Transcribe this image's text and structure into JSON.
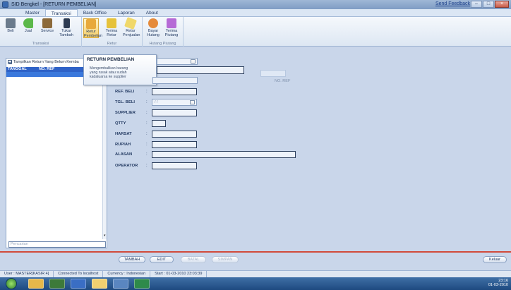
{
  "window": {
    "title": "SID Bengkel - [RETURN PEMBELIAN]",
    "send_feedback": "Send Feedback",
    "min": "–",
    "max": "□",
    "close": "×"
  },
  "ribbon": {
    "tabs": [
      "Master",
      "Transaksi",
      "Back Office",
      "Laporan",
      "About"
    ],
    "groups": {
      "transaksi": {
        "label": "Transaksi",
        "buttons": [
          "Beli",
          "Jual",
          "Service",
          "Tukar Tambah"
        ]
      },
      "retur": {
        "label": "Retur",
        "buttons": [
          "Retur Pembelian",
          "Terima Retur",
          "Retur Penjualan"
        ]
      },
      "hutang": {
        "label": "Hutang Piutang",
        "buttons": [
          "Bayar Hutang",
          "Terima Piutang"
        ]
      }
    }
  },
  "tooltip": {
    "title": "RETURN PEMBELIAN",
    "body": "Mengembalikan barang yang rusak atau sudah kadaluarsa ke supplier"
  },
  "left_panel": {
    "checkbox_label": "Tampilkan Return Yang Belum Kemba",
    "columns": [
      "TANGGAL",
      "NO. REF"
    ],
    "search_placeholder": "Pencarian"
  },
  "form": {
    "no_field": "NO. REF",
    "fields": [
      {
        "label": "REF. BELI",
        "value": ""
      },
      {
        "label": "TGL. BELI",
        "value": "/ /"
      },
      {
        "label": "SUPPLIER",
        "value": ""
      },
      {
        "label": "QTTY",
        "value": ""
      },
      {
        "label": "HARSAT",
        "value": ""
      },
      {
        "label": "RUPIAH",
        "value": ""
      },
      {
        "label": "ALASAN",
        "value": ""
      },
      {
        "label": "OPERATOR",
        "value": ""
      }
    ],
    "colon": ":"
  },
  "actions": {
    "tambah": "TAMBAH",
    "edit": "EDIT",
    "batal": "BATAL",
    "simpan": "SIMPAN",
    "keluar": "Keluar"
  },
  "status": {
    "user": "User : MASTER[KASIR 4]",
    "connection": "Connected To localhost",
    "currency": "Currency : Indonesian",
    "start": "Start : 01-03-2010 23:03:39"
  },
  "taskbar": {
    "time": "23:16",
    "date": "01-03-2010"
  },
  "colors": {
    "accent": "#2f62c7",
    "separator": "#d14b3b",
    "background": "#c9d6ea"
  }
}
